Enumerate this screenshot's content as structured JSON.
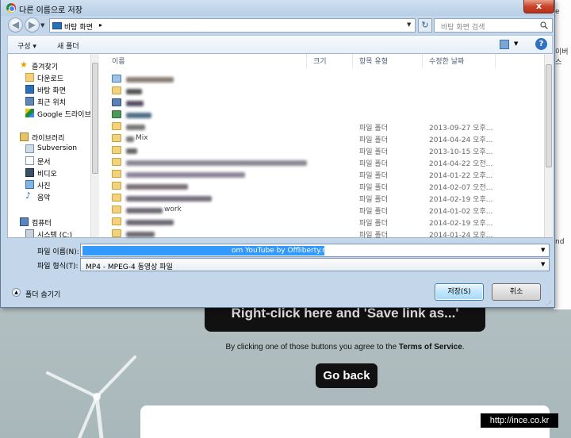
{
  "background_page": {
    "right_click_button": "Right-click here and 'Save link as...'",
    "terms_prefix": "By clicking one of those buttons you agree to the ",
    "terms_link": "Terms of Service",
    "terms_suffix": ".",
    "go_back": "Go back",
    "right_edge_texts": [
      "e",
      "이버 스",
      "nd"
    ],
    "watermark": "http://ince.co.kr"
  },
  "dialog": {
    "title": "다른 이름으로 저장",
    "close_symbol": "x",
    "address": {
      "location": "바탕 화면",
      "separator": "▸"
    },
    "search_placeholder": "바탕 화면 검색",
    "refresh_symbol": "↻",
    "toolbar": {
      "organize": "구성 ▾",
      "new_folder": "새 폴더",
      "help": "?"
    },
    "nav_items": [
      {
        "label": "즐겨찾기",
        "icon": "star-icon"
      },
      {
        "label": "다운로드",
        "icon": "downloads-folder-icon"
      },
      {
        "label": "바탕 화면",
        "icon": "desktop-icon"
      },
      {
        "label": "최근 위치",
        "icon": "recent-places-icon"
      },
      {
        "label": "Google 드라이브",
        "icon": "google-drive-icon"
      },
      {
        "label": "라이브러리",
        "icon": "libraries-icon"
      },
      {
        "label": "Subversion",
        "icon": "subversion-library-icon"
      },
      {
        "label": "문서",
        "icon": "documents-icon"
      },
      {
        "label": "비디오",
        "icon": "videos-icon"
      },
      {
        "label": "사진",
        "icon": "pictures-icon"
      },
      {
        "label": "음악",
        "icon": "music-icon"
      },
      {
        "label": "컴퓨터",
        "icon": "computer-icon"
      },
      {
        "label": "시스템 (C:)",
        "icon": "drive-icon"
      }
    ],
    "columns": {
      "name": "이름",
      "size": "크기",
      "type": "항목 유형",
      "modified": "수정한 날짜"
    },
    "files": [
      {
        "type": "",
        "date": ""
      },
      {
        "type": "",
        "date": ""
      },
      {
        "type": "",
        "date": ""
      },
      {
        "type": "",
        "date": ""
      },
      {
        "type": "파일 폴더",
        "date": "2013-09-27 오후..."
      },
      {
        "type": "파일 폴더",
        "date": "2014-04-24 오후..."
      },
      {
        "type": "파일 폴더",
        "date": "2013-10-15 오후..."
      },
      {
        "type": "파일 폴더",
        "date": "2014-04-22 오전..."
      },
      {
        "type": "파일 폴더",
        "date": "2014-01-22 오후..."
      },
      {
        "type": "파일 폴더",
        "date": "2014-02-07 오전..."
      },
      {
        "type": "파일 폴더",
        "date": "2014-02-19 오후..."
      },
      {
        "type": "파일 폴더",
        "date": "2014-01-02 오후..."
      },
      {
        "type": "파일 폴더",
        "date": "2014-02-19 오후..."
      },
      {
        "type": "파일 폴더",
        "date": "2014-01-24 오후..."
      }
    ],
    "visible_file_fragments": {
      "row5": "Mix",
      "row11": "work"
    },
    "filename_label": "파일 이름(N):",
    "filename_value": "om YouTube by Offliberty.mp4",
    "filetype_label": "파일 형식(T):",
    "filetype_value": "MP4 - MPEG-4 동영상 파일",
    "hide_folders": "폴더 숨기기",
    "save_button": "저장(S)",
    "cancel_button": "취소"
  }
}
